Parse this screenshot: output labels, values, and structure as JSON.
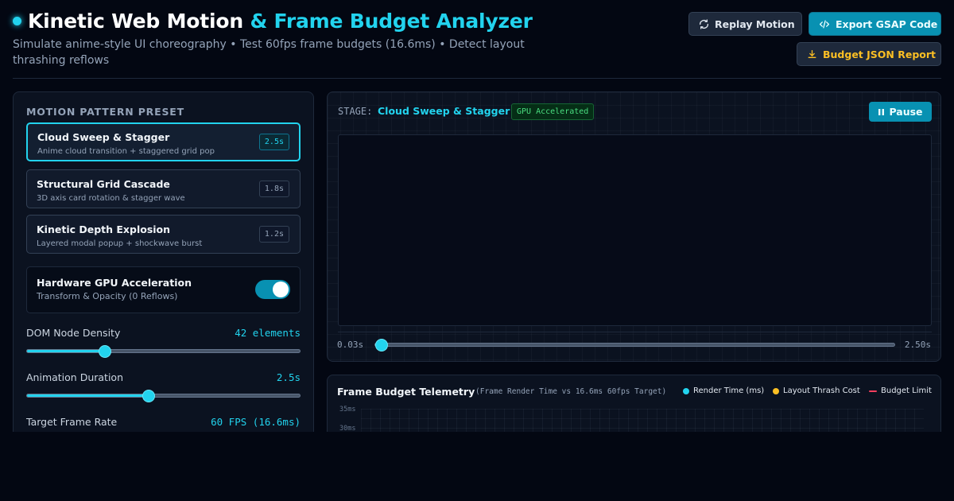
{
  "header": {
    "title_main": "Kinetic Web Motion",
    "title_accent": "& Frame Budget Analyzer",
    "subtitle": "Simulate anime-style UI choreography • Test 60fps frame budgets (16.6ms) • Detect layout thrashing reflows",
    "replay_label": "Replay Motion",
    "export_label": "Export GSAP Code",
    "budget_label": "Budget JSON Report"
  },
  "sidebar": {
    "section_label": "MOTION PATTERN PRESET",
    "presets": [
      {
        "title": "Cloud Sweep & Stagger",
        "desc": "Anime cloud transition + staggered grid pop",
        "duration": "2.5s",
        "active": true
      },
      {
        "title": "Structural Grid Cascade",
        "desc": "3D axis card rotation & stagger wave",
        "duration": "1.8s",
        "active": false
      },
      {
        "title": "Kinetic Depth Explosion",
        "desc": "Layered modal popup + shockwave burst",
        "duration": "1.2s",
        "active": false
      }
    ],
    "gpu": {
      "title": "Hardware GPU Acceleration",
      "desc": "Transform & Opacity (0 Reflows)",
      "enabled": true
    },
    "sliders": [
      {
        "label": "DOM Node Density",
        "value": "42 elements",
        "fraction": 0.285
      },
      {
        "label": "Animation Duration",
        "value": "2.5s",
        "fraction": 0.445
      },
      {
        "label": "Target Frame Rate",
        "value": "60 FPS (16.6ms)"
      }
    ]
  },
  "stage": {
    "label": "STAGE:",
    "preset_name": "Cloud Sweep & Stagger",
    "badge": "GPU Accelerated",
    "pause_label": "Pause",
    "time_current": "0.03s",
    "time_total": "2.50s",
    "progress_fraction": 0.012
  },
  "telemetry": {
    "title": "Frame Budget Telemetry",
    "subtitle": "(Frame Render Time vs 16.6ms 60fps Target)",
    "legend": [
      {
        "label": "Render Time (ms)",
        "color": "#22d3ee"
      },
      {
        "label": "Layout Thrash Cost",
        "color": "#fbbf24"
      },
      {
        "label": "Budget Limit",
        "color": "#f43f5e"
      }
    ],
    "y_ticks": [
      "35ms",
      "30ms"
    ]
  },
  "colors": {
    "accent": "#22d3ee",
    "accent_dark": "#0891b2",
    "warning": "#fbbf24",
    "success": "#4ade80",
    "danger": "#f43f5e",
    "background": "#030712"
  }
}
